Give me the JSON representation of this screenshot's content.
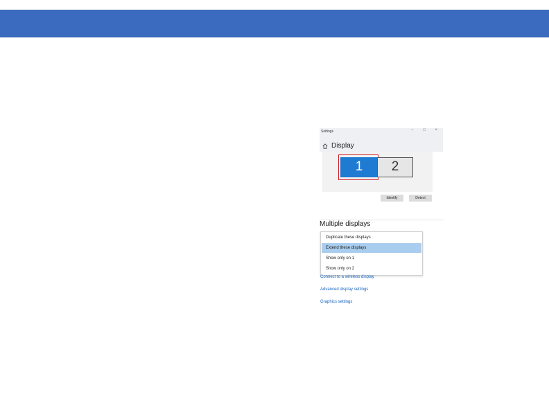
{
  "window": {
    "title": "Settings",
    "controls": [
      "–",
      "□",
      "×"
    ]
  },
  "page": {
    "title": "Display"
  },
  "arrangement": {
    "monitors": [
      "1",
      "2"
    ],
    "identify_label": "Identify",
    "detect_label": "Detect"
  },
  "multiple_displays": {
    "heading": "Multiple displays",
    "options": [
      "Duplicate these displays",
      "Extend these displays",
      "Show only on 1",
      "Show only on 2"
    ],
    "selected_index": 1
  },
  "links": [
    "Connect to a wireless display",
    "Advanced display settings",
    "Graphics settings"
  ],
  "colors": {
    "banner": "#3b6bbf",
    "monitor_selected": "#1f7ad1",
    "highlight_outline": "#d1232a",
    "option_selected": "#a9cdee",
    "link": "#1a66c2"
  }
}
